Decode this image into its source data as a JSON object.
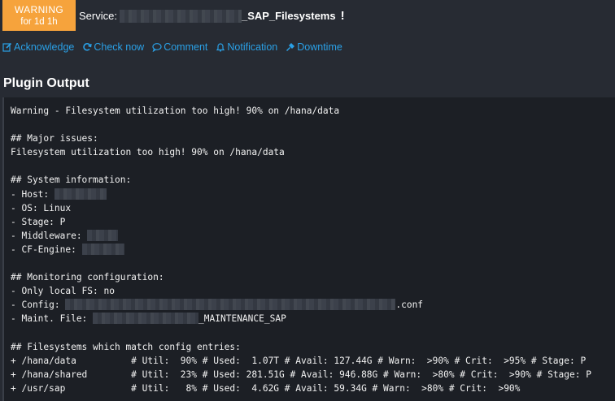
{
  "header": {
    "state": "WARNING",
    "duration": "for 1d 1h",
    "service_label": "Service:",
    "service_name": "_SAP_Filesystems",
    "service_flag": "!"
  },
  "actions": [
    {
      "label": "Acknowledge",
      "icon": "edit-icon"
    },
    {
      "label": "Check now",
      "icon": "refresh-icon"
    },
    {
      "label": "Comment",
      "icon": "comment-icon"
    },
    {
      "label": "Notification",
      "icon": "bell-icon"
    },
    {
      "label": "Downtime",
      "icon": "plug-icon"
    }
  ],
  "plugin_output": {
    "title": "Plugin Output",
    "summary": "Warning - Filesystem utilization too high! 90% on /hana/data",
    "major_heading": "## Major issues:",
    "major_issue": "Filesystem utilization too high! 90% on /hana/data",
    "sysinfo_heading": "## System information:",
    "host_label": "- Host: ",
    "os_line": "- OS: Linux",
    "stage_line": "- Stage: P",
    "middleware_label": "- Middleware: ",
    "cfengine_label": "- CF-Engine: ",
    "monitoring_heading": "## Monitoring configuration:",
    "localfs_line": "- Only local FS: no",
    "config_label": "- Config: ",
    "config_suffix": ".conf",
    "maint_label": "- Maint. File: ",
    "maint_suffix": "_MAINTENANCE_SAP",
    "fs_heading": "## Filesystems which match config entries:",
    "fs_lines": [
      "+ /hana/data          # Util:  90% # Used:  1.07T # Avail: 127.44G # Warn:  >90% # Crit:  >95% # Stage: P",
      "+ /hana/shared        # Util:  23% # Used: 281.51G # Avail: 946.88G # Warn:  >80% # Crit:  >90% # Stage: P",
      "+ /usr/sap            # Util:   8% # Used:  4.62G # Avail: 59.34G # Warn:  >80% # Crit:  >90%"
    ]
  },
  "colors": {
    "warning": "#f6a33c",
    "link": "#2aa0e6",
    "background": "#272b33",
    "output_background": "#1c1f25"
  }
}
